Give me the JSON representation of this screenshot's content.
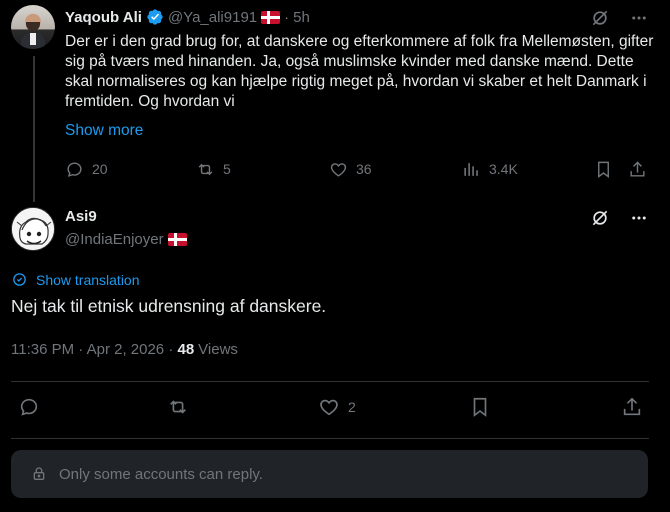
{
  "parent_post": {
    "author_name": "Yaqoub Ali",
    "handle": "@Ya_ali9191",
    "time_sep": "·",
    "time": "5h",
    "text": "Der er i den grad brug for, at danskere og efterkommere af folk fra Mellemøsten, gifter sig på tværs med hinanden. Ja, også muslimske kvinder med danske mænd. Dette skal normaliseres og kan hjælpe rigtig meget på, hvordan vi skaber et helt Danmark i fremtiden. Og hvordan vi",
    "show_more": "Show more",
    "actions": {
      "replies": "20",
      "reposts": "5",
      "likes": "36",
      "views": "3.4K"
    },
    "icons": [
      "verified-badge-icon",
      "denmark-flag-icon",
      "grok-icon",
      "more-icon",
      "reply-icon",
      "repost-icon",
      "like-icon",
      "views-icon",
      "bookmark-icon",
      "share-icon"
    ]
  },
  "reply_post": {
    "author_name": "Asi9",
    "handle": "@IndiaEnjoyer",
    "translate_label": "Show translation",
    "text": "Nej tak til etnisk udrensning af danskere.",
    "timestamp": "11:36 PM · Apr 2, 2026 · ",
    "views_count": "48",
    "views_label": "Views",
    "actions": {
      "likes": "2"
    }
  },
  "reply_restriction": "Only some accounts can reply.",
  "colors": {
    "background": "#000000",
    "text": "#e7e9ea",
    "muted": "#71767b",
    "accent": "#1d9bf0",
    "divider": "#2f3336",
    "reply_box": "#202327"
  }
}
